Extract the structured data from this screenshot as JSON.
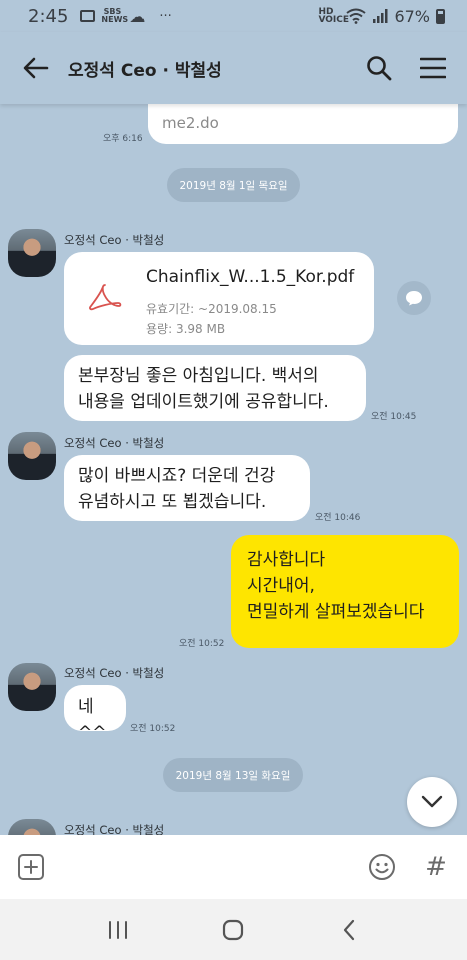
{
  "status_bar": {
    "time": "2:45",
    "battery": "67%",
    "sbs_label": "SBS NEWS",
    "hd_label": "HD VOICE",
    "more": "···"
  },
  "header": {
    "title": "오정석 Ceo · 박철성"
  },
  "messages": {
    "link_preview_text": "me2.do",
    "link_time": "오후 6:16",
    "date_1": "2019년 8월 1일 목요일",
    "sender_1": "오정석 Ceo · 박철성",
    "file_name": "Chainflix_W...1.5_Kor.pdf",
    "file_expiry": "유효기간: ~2019.08.15",
    "file_size": "용량: 3.98 MB",
    "msg_1_line1": "본부장님 좋은 아침입니다. 백서의",
    "msg_1_line2": "내용을 업데이트했기에 공유합니다.",
    "msg_1_time": "오전 10:45",
    "sender_2": "오정석 Ceo · 박철성",
    "msg_2_line1": "많이 바쁘시죠? 더운데 건강",
    "msg_2_line2": "유념하시고 또 뵙겠습니다.",
    "msg_2_time": "오전 10:46",
    "my_msg_line1": "감사합니다",
    "my_msg_line2": "시간내어,",
    "my_msg_line3": "면밀하게 살펴보겠습니다",
    "my_msg_time": "오전 10:52",
    "sender_3": "오정석 Ceo · 박철성",
    "msg_3": "네^^",
    "msg_3_time": "오전 10:52",
    "date_2": "2019년 8월 13일 화요일",
    "sender_4": "오정석 Ceo · 박철성"
  },
  "input_bar": {
    "hash_label": "#"
  },
  "colors": {
    "chat_background": "#b2c7d9",
    "my_bubble": "#fee500",
    "other_bubble": "#ffffff",
    "pdf_icon": "#d9534f"
  },
  "icons": {
    "back": "arrow-left-icon",
    "search": "search-icon",
    "menu": "hamburger-menu-icon",
    "pdf": "pdf-icon",
    "share": "share-bubble-icon",
    "scroll_down": "chevron-down-icon",
    "attach": "plus-square-icon",
    "emoji": "smiley-icon",
    "nav_recents": "recents-icon",
    "nav_home": "home-icon",
    "nav_back": "nav-back-icon"
  }
}
